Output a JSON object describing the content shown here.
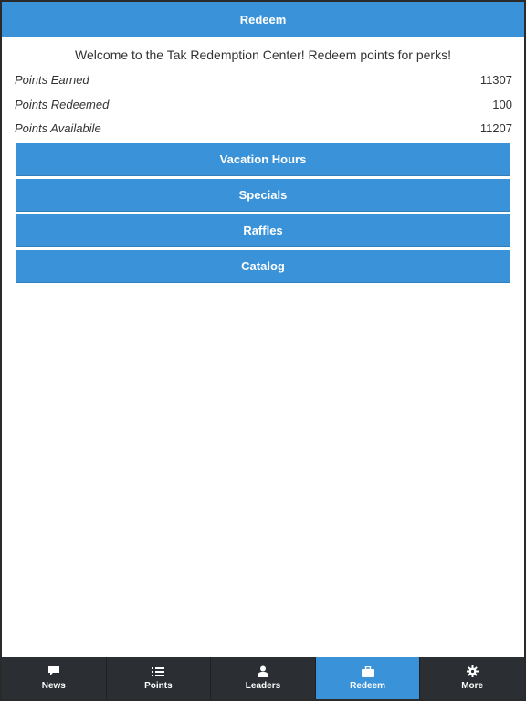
{
  "header": {
    "title": "Redeem"
  },
  "welcome_text": "Welcome to the Tak Redemption Center! Redeem points for perks!",
  "stats": {
    "earned": {
      "label": "Points Earned",
      "value": "11307"
    },
    "redeemed": {
      "label": "Points Redeemed",
      "value": "100"
    },
    "available": {
      "label": "Points Availabile",
      "value": "11207"
    }
  },
  "buttons": {
    "vacation": "Vacation Hours",
    "specials": "Specials",
    "raffles": "Raffles",
    "catalog": "Catalog"
  },
  "tabs": [
    {
      "label": "News",
      "icon": "chat-bubble-icon"
    },
    {
      "label": "Points",
      "icon": "list-icon"
    },
    {
      "label": "Leaders",
      "icon": "user-icon"
    },
    {
      "label": "Redeem",
      "icon": "briefcase-icon",
      "active": true
    },
    {
      "label": "More",
      "icon": "gear-icon"
    }
  ],
  "colors": {
    "accent": "#3a93d8",
    "tabbar": "#2b2e33",
    "text": "#333333"
  }
}
